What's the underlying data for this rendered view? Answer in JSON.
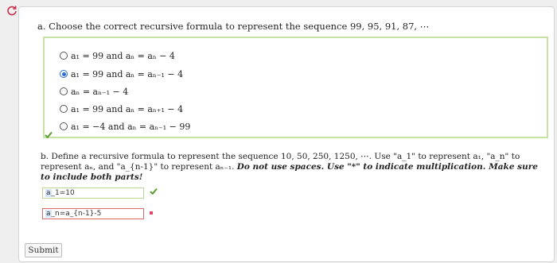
{
  "browser": {
    "icon": "reload-icon"
  },
  "part_a": {
    "prompt": "a. Choose the correct recursive formula to represent the sequence 99, 95, 91, 87, ⋯",
    "options": [
      {
        "text": "a₁ = 99 and aₙ = aₙ − 4",
        "selected": false
      },
      {
        "text": "a₁ = 99 and aₙ = aₙ₋₁ − 4",
        "selected": true
      },
      {
        "text": "aₙ = aₙ₋₁ − 4",
        "selected": false
      },
      {
        "text": "a₁ = 99 and aₙ = aₙ₊₁ − 4",
        "selected": false
      },
      {
        "text": "a₁ = −4 and aₙ = aₙ₋₁ − 99",
        "selected": false
      }
    ],
    "status": "correct",
    "status_color": "#5a9e2f"
  },
  "part_b": {
    "prompt": "b. Define a recursive formula to represent the sequence 10, 50, 250, 1250, ⋯. Use \"a_1\" to represent a₁, \"a_n\" to represent aₙ, and \"a_{n-1}\" to represent aₙ₋₁.",
    "instructions": "Do not use spaces. Use \"*\" to indicate multiplication. Make sure to include both parts!",
    "input1_prefix": "a",
    "input1_value": "_1=10",
    "input1_status": "correct",
    "input2_prefix": "a",
    "input2_value": "_n=a_{n-1}-5",
    "input2_status": "incorrect",
    "incorrect_color": "#e0446b"
  },
  "submit_label": "Submit"
}
